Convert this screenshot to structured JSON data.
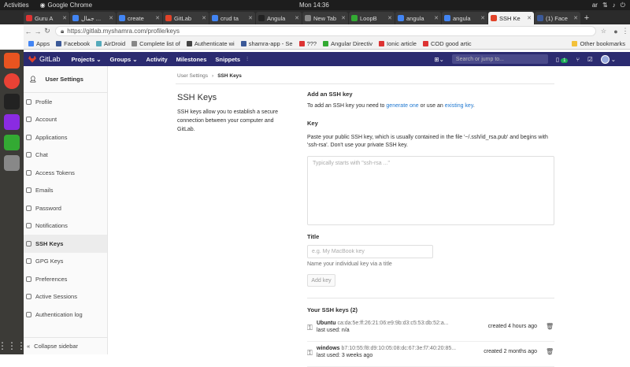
{
  "os": {
    "activities": "Activities",
    "app": "Google Chrome",
    "clock": "Mon 14:36",
    "lang": "ar"
  },
  "tabs": [
    {
      "label": "Guru A",
      "color": "#d33"
    },
    {
      "label": "جمال ...",
      "color": "#4285f4"
    },
    {
      "label": "create",
      "color": "#4285f4"
    },
    {
      "label": "GitLab",
      "color": "#e24329"
    },
    {
      "label": "crud ta",
      "color": "#4285f4"
    },
    {
      "label": "Angula",
      "color": "#222"
    },
    {
      "label": "New Tab",
      "color": "#888"
    },
    {
      "label": "LoopB",
      "color": "#3a3"
    },
    {
      "label": "angula",
      "color": "#4285f4"
    },
    {
      "label": "angula",
      "color": "#4285f4"
    },
    {
      "label": "SSH Ke",
      "color": "#e24329",
      "active": true
    },
    {
      "label": "(1) Face",
      "color": "#3b5998"
    }
  ],
  "url": "https://gitlab.myshamra.com/profile/keys",
  "bookmarks": [
    {
      "label": "Apps",
      "color": "#4285f4"
    },
    {
      "label": "Facebook",
      "color": "#3b5998"
    },
    {
      "label": "AirDroid",
      "color": "#5ab"
    },
    {
      "label": "Complete list of",
      "color": "#888"
    },
    {
      "label": "Authenticate wi",
      "color": "#444"
    },
    {
      "label": "shamra-app - Se",
      "color": "#3b5998"
    },
    {
      "label": "???",
      "color": "#d33"
    },
    {
      "label": "Angular Directiv",
      "color": "#3a3"
    },
    {
      "label": "Ionic article",
      "color": "#d33"
    },
    {
      "label": "COD good artic",
      "color": "#d33"
    }
  ],
  "other_bookmarks": "Other bookmarks",
  "gitlab": {
    "brand": "GitLab",
    "menu": [
      "Projects ⌄",
      "Groups ⌄",
      "Activity",
      "Milestones",
      "Snippets"
    ],
    "search_placeholder": "Search or jump to...",
    "badge": "1"
  },
  "sidebar": {
    "title": "User Settings",
    "items": [
      "Profile",
      "Account",
      "Applications",
      "Chat",
      "Access Tokens",
      "Emails",
      "Password",
      "Notifications",
      "SSH Keys",
      "GPG Keys",
      "Preferences",
      "Active Sessions",
      "Authentication log"
    ],
    "active_index": 8,
    "collapse": "Collapse sidebar"
  },
  "breadcrumb": {
    "parent": "User Settings",
    "sep": "›",
    "current": "SSH Keys"
  },
  "intro": {
    "title": "SSH Keys",
    "text": "SSH keys allow you to establish a secure connection between your computer and GitLab."
  },
  "form": {
    "heading": "Add an SSH key",
    "lead_pre": "To add an SSH key you need to ",
    "link1": "generate one",
    "lead_mid": " or use an ",
    "link2": "existing key",
    "lead_post": ".",
    "key_label": "Key",
    "key_help": "Paste your public SSH key, which is usually contained in the file '~/.ssh/id_rsa.pub' and begins with 'ssh-rsa'. Don't use your private SSH key.",
    "key_placeholder": "Typically starts with \"ssh-rsa ...\"",
    "title_label": "Title",
    "title_placeholder": "e.g. My MacBook key",
    "title_help": "Name your individual key via a title",
    "add_button": "Add key"
  },
  "keys": {
    "heading": "Your SSH keys (2)",
    "items": [
      {
        "name": "Ubuntu",
        "fingerprint": "ca:da:5e:ff:26:21:06:e9:9b:d3:c5:53:db:52:a...",
        "last_used": "last used: n/a",
        "created": "created 4 hours ago"
      },
      {
        "name": "windows",
        "fingerprint": "b7:10:55:f8:d9:10:05:08:dc:67:3e:f7:40:20:85...",
        "last_used": "last used: 3 weeks ago",
        "created": "created 2 months ago"
      }
    ]
  }
}
